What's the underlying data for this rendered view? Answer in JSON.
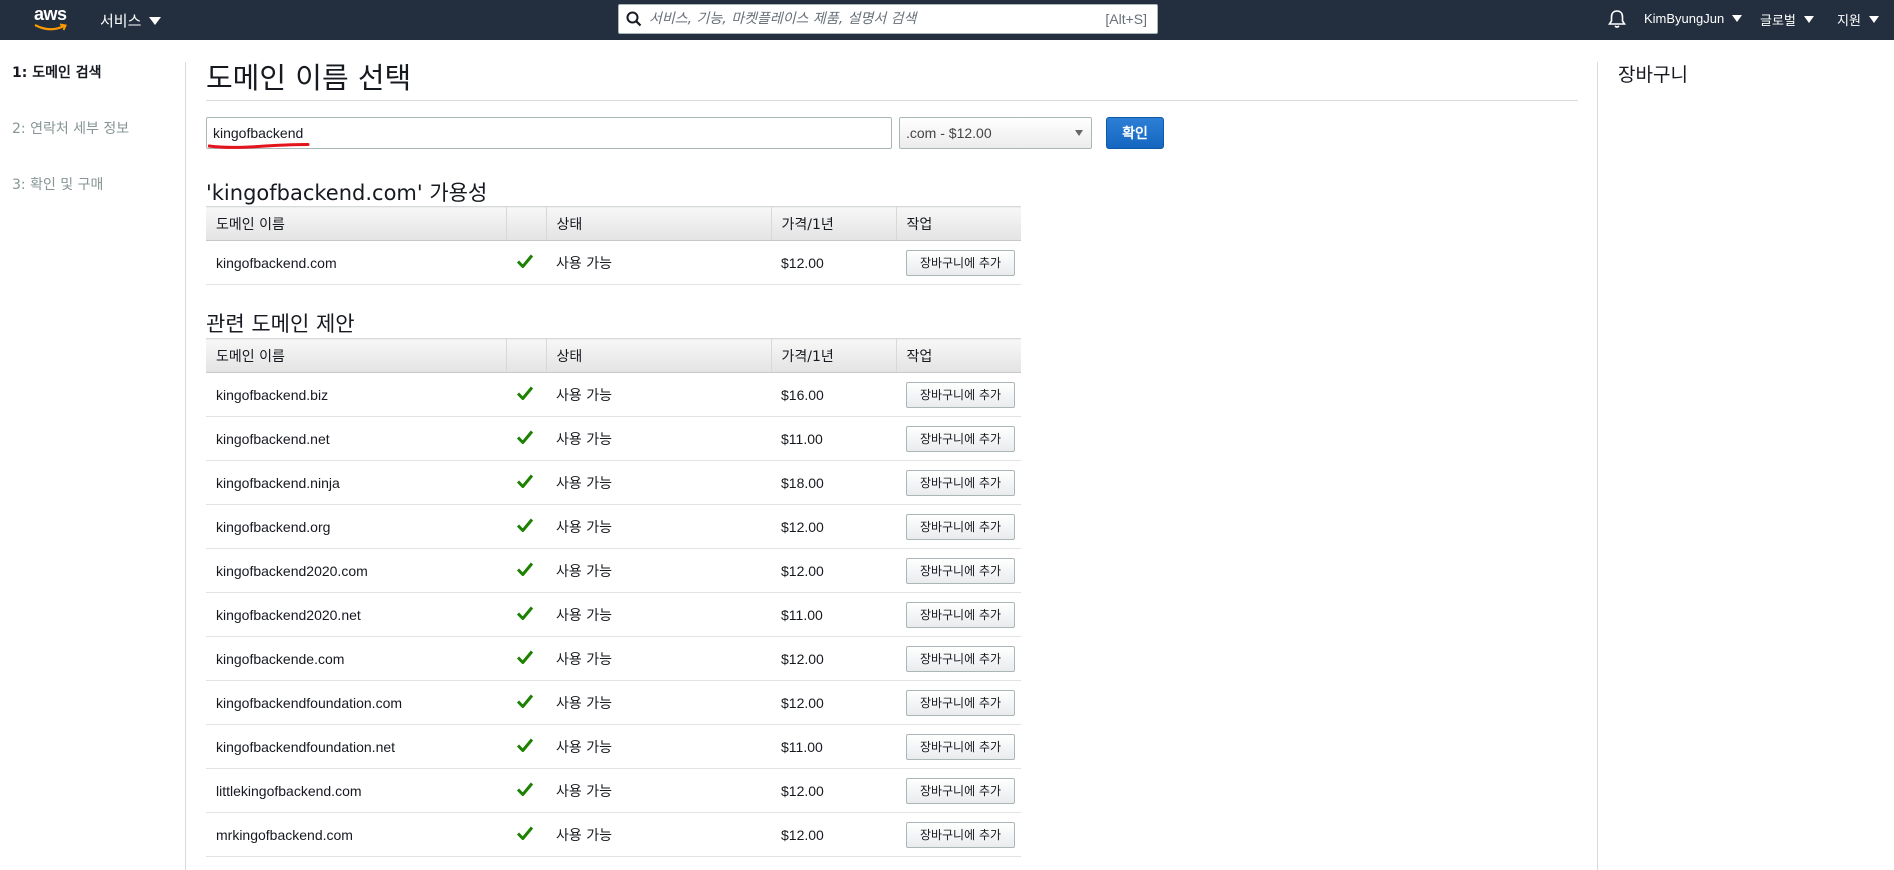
{
  "nav": {
    "logo_text": "aws",
    "services_label": "서비스",
    "search_placeholder": "서비스, 기능, 마켓플레이스 제품, 설명서 검색",
    "search_shortcut": "[Alt+S]",
    "user_label": "KimByungJun",
    "region_label": "글로벌",
    "support_label": "지원"
  },
  "steps": [
    {
      "label": "1: 도메인 검색",
      "active": true
    },
    {
      "label": "2: 연락처 세부 정보",
      "active": false
    },
    {
      "label": "3: 확인 및 구매",
      "active": false
    }
  ],
  "main": {
    "title": "도메인 이름 선택",
    "search_value": "kingofbackend",
    "tld_selected": ".com - $12.00",
    "confirm_label": "확인",
    "availability_title": "'kingofbackend.com' 가용성",
    "related_title": "관련 도메인 제안"
  },
  "table_headers": {
    "name": "도메인 이름",
    "status": "상태",
    "price": "가격/1년",
    "action": "작업"
  },
  "availability_rows": [
    {
      "name": "kingofbackend.com",
      "status": "사용 가능",
      "price": "$12.00",
      "action": "장바구니에 추가"
    }
  ],
  "related_rows": [
    {
      "name": "kingofbackend.biz",
      "status": "사용 가능",
      "price": "$16.00",
      "action": "장바구니에 추가"
    },
    {
      "name": "kingofbackend.net",
      "status": "사용 가능",
      "price": "$11.00",
      "action": "장바구니에 추가"
    },
    {
      "name": "kingofbackend.ninja",
      "status": "사용 가능",
      "price": "$18.00",
      "action": "장바구니에 추가"
    },
    {
      "name": "kingofbackend.org",
      "status": "사용 가능",
      "price": "$12.00",
      "action": "장바구니에 추가"
    },
    {
      "name": "kingofbackend2020.com",
      "status": "사용 가능",
      "price": "$12.00",
      "action": "장바구니에 추가"
    },
    {
      "name": "kingofbackend2020.net",
      "status": "사용 가능",
      "price": "$11.00",
      "action": "장바구니에 추가"
    },
    {
      "name": "kingofbackende.com",
      "status": "사용 가능",
      "price": "$12.00",
      "action": "장바구니에 추가"
    },
    {
      "name": "kingofbackendfoundation.com",
      "status": "사용 가능",
      "price": "$12.00",
      "action": "장바구니에 추가"
    },
    {
      "name": "kingofbackendfoundation.net",
      "status": "사용 가능",
      "price": "$11.00",
      "action": "장바구니에 추가"
    },
    {
      "name": "littlekingofbackend.com",
      "status": "사용 가능",
      "price": "$12.00",
      "action": "장바구니에 추가"
    },
    {
      "name": "mrkingofbackend.com",
      "status": "사용 가능",
      "price": "$12.00",
      "action": "장바구니에 추가"
    }
  ],
  "cart": {
    "title": "장바구니"
  },
  "colors": {
    "nav_bg": "#232f3e",
    "primary_button": "#1466c0",
    "check_green": "#1d8102",
    "annotation_red": "#e3141b"
  },
  "icons": {
    "search": "search-icon",
    "bell": "bell-icon",
    "check": "check-icon",
    "caret": "caret-down-icon"
  }
}
